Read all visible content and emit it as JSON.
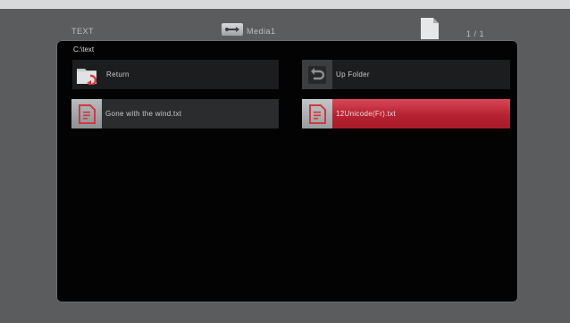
{
  "header": {
    "section_title": "TEXT",
    "device_label": "Media1",
    "page_counter": "1 / 1"
  },
  "browser": {
    "current_path": "C:\\text",
    "items": [
      {
        "label": "Return",
        "icon": "return-folder-icon"
      },
      {
        "label": "Up Folder",
        "icon": "up-folder-icon"
      },
      {
        "label": "Gone with the wind.txt",
        "icon": "text-file-icon"
      },
      {
        "label": "12Unicode(Fr).txt",
        "icon": "text-file-icon",
        "selected": true
      }
    ]
  },
  "colors": {
    "selection": "#c0283a",
    "panel": "#030303",
    "frame": "#5a5c5e"
  }
}
